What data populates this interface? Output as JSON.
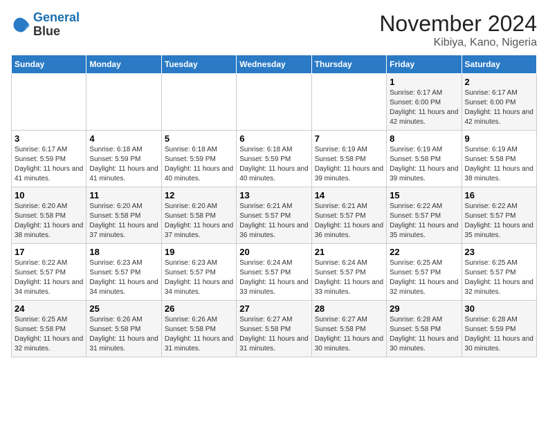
{
  "logo": {
    "line1": "General",
    "line2": "Blue"
  },
  "title": "November 2024",
  "location": "Kibiya, Kano, Nigeria",
  "weekdays": [
    "Sunday",
    "Monday",
    "Tuesday",
    "Wednesday",
    "Thursday",
    "Friday",
    "Saturday"
  ],
  "weeks": [
    [
      {
        "day": "",
        "info": ""
      },
      {
        "day": "",
        "info": ""
      },
      {
        "day": "",
        "info": ""
      },
      {
        "day": "",
        "info": ""
      },
      {
        "day": "",
        "info": ""
      },
      {
        "day": "1",
        "info": "Sunrise: 6:17 AM\nSunset: 6:00 PM\nDaylight: 11 hours and 42 minutes."
      },
      {
        "day": "2",
        "info": "Sunrise: 6:17 AM\nSunset: 6:00 PM\nDaylight: 11 hours and 42 minutes."
      }
    ],
    [
      {
        "day": "3",
        "info": "Sunrise: 6:17 AM\nSunset: 5:59 PM\nDaylight: 11 hours and 41 minutes."
      },
      {
        "day": "4",
        "info": "Sunrise: 6:18 AM\nSunset: 5:59 PM\nDaylight: 11 hours and 41 minutes."
      },
      {
        "day": "5",
        "info": "Sunrise: 6:18 AM\nSunset: 5:59 PM\nDaylight: 11 hours and 40 minutes."
      },
      {
        "day": "6",
        "info": "Sunrise: 6:18 AM\nSunset: 5:59 PM\nDaylight: 11 hours and 40 minutes."
      },
      {
        "day": "7",
        "info": "Sunrise: 6:19 AM\nSunset: 5:58 PM\nDaylight: 11 hours and 39 minutes."
      },
      {
        "day": "8",
        "info": "Sunrise: 6:19 AM\nSunset: 5:58 PM\nDaylight: 11 hours and 39 minutes."
      },
      {
        "day": "9",
        "info": "Sunrise: 6:19 AM\nSunset: 5:58 PM\nDaylight: 11 hours and 38 minutes."
      }
    ],
    [
      {
        "day": "10",
        "info": "Sunrise: 6:20 AM\nSunset: 5:58 PM\nDaylight: 11 hours and 38 minutes."
      },
      {
        "day": "11",
        "info": "Sunrise: 6:20 AM\nSunset: 5:58 PM\nDaylight: 11 hours and 37 minutes."
      },
      {
        "day": "12",
        "info": "Sunrise: 6:20 AM\nSunset: 5:58 PM\nDaylight: 11 hours and 37 minutes."
      },
      {
        "day": "13",
        "info": "Sunrise: 6:21 AM\nSunset: 5:57 PM\nDaylight: 11 hours and 36 minutes."
      },
      {
        "day": "14",
        "info": "Sunrise: 6:21 AM\nSunset: 5:57 PM\nDaylight: 11 hours and 36 minutes."
      },
      {
        "day": "15",
        "info": "Sunrise: 6:22 AM\nSunset: 5:57 PM\nDaylight: 11 hours and 35 minutes."
      },
      {
        "day": "16",
        "info": "Sunrise: 6:22 AM\nSunset: 5:57 PM\nDaylight: 11 hours and 35 minutes."
      }
    ],
    [
      {
        "day": "17",
        "info": "Sunrise: 6:22 AM\nSunset: 5:57 PM\nDaylight: 11 hours and 34 minutes."
      },
      {
        "day": "18",
        "info": "Sunrise: 6:23 AM\nSunset: 5:57 PM\nDaylight: 11 hours and 34 minutes."
      },
      {
        "day": "19",
        "info": "Sunrise: 6:23 AM\nSunset: 5:57 PM\nDaylight: 11 hours and 34 minutes."
      },
      {
        "day": "20",
        "info": "Sunrise: 6:24 AM\nSunset: 5:57 PM\nDaylight: 11 hours and 33 minutes."
      },
      {
        "day": "21",
        "info": "Sunrise: 6:24 AM\nSunset: 5:57 PM\nDaylight: 11 hours and 33 minutes."
      },
      {
        "day": "22",
        "info": "Sunrise: 6:25 AM\nSunset: 5:57 PM\nDaylight: 11 hours and 32 minutes."
      },
      {
        "day": "23",
        "info": "Sunrise: 6:25 AM\nSunset: 5:57 PM\nDaylight: 11 hours and 32 minutes."
      }
    ],
    [
      {
        "day": "24",
        "info": "Sunrise: 6:25 AM\nSunset: 5:58 PM\nDaylight: 11 hours and 32 minutes."
      },
      {
        "day": "25",
        "info": "Sunrise: 6:26 AM\nSunset: 5:58 PM\nDaylight: 11 hours and 31 minutes."
      },
      {
        "day": "26",
        "info": "Sunrise: 6:26 AM\nSunset: 5:58 PM\nDaylight: 11 hours and 31 minutes."
      },
      {
        "day": "27",
        "info": "Sunrise: 6:27 AM\nSunset: 5:58 PM\nDaylight: 11 hours and 31 minutes."
      },
      {
        "day": "28",
        "info": "Sunrise: 6:27 AM\nSunset: 5:58 PM\nDaylight: 11 hours and 30 minutes."
      },
      {
        "day": "29",
        "info": "Sunrise: 6:28 AM\nSunset: 5:58 PM\nDaylight: 11 hours and 30 minutes."
      },
      {
        "day": "30",
        "info": "Sunrise: 6:28 AM\nSunset: 5:59 PM\nDaylight: 11 hours and 30 minutes."
      }
    ]
  ]
}
